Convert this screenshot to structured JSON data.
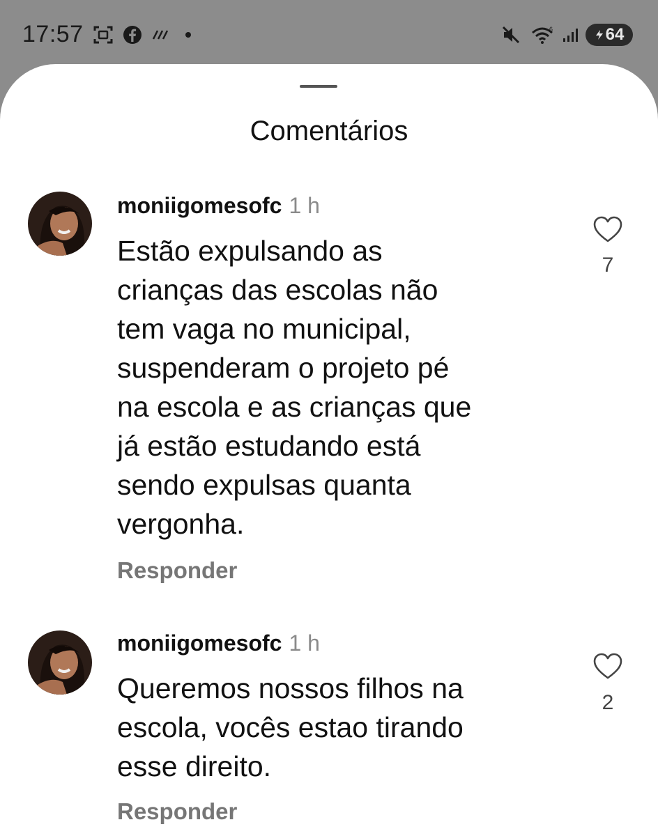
{
  "status_bar": {
    "time": "17:57",
    "left_icons": [
      "screenshot-icon",
      "facebook-icon",
      "signal-flag-icon",
      "dot-icon"
    ],
    "right_icons": [
      "mute-icon",
      "wifi-icon",
      "cell-signal-icon"
    ],
    "battery": "64"
  },
  "sheet": {
    "title": "Comentários"
  },
  "comments": [
    {
      "username": "moniigomesofc",
      "time_ago": "1 h",
      "lines": [
        "Estão expulsando as",
        "crianças das escolas não",
        "tem vaga no municipal,",
        "suspenderam o projeto pé",
        "na escola e as crianças que",
        "já estão estudando está",
        "sendo expulsas quanta",
        "vergonha."
      ],
      "reply_label": "Responder",
      "likes": "7"
    },
    {
      "username": "moniigomesofc",
      "time_ago": "1 h",
      "lines": [
        "Queremos nossos filhos na",
        "escola, vocês estao tirando",
        "esse direito."
      ],
      "reply_label": "Responder",
      "likes": "2"
    }
  ],
  "colors": {
    "status_bar_bg": "#8c8c8c",
    "sheet_bg": "#ffffff",
    "muted_text": "#767676"
  }
}
